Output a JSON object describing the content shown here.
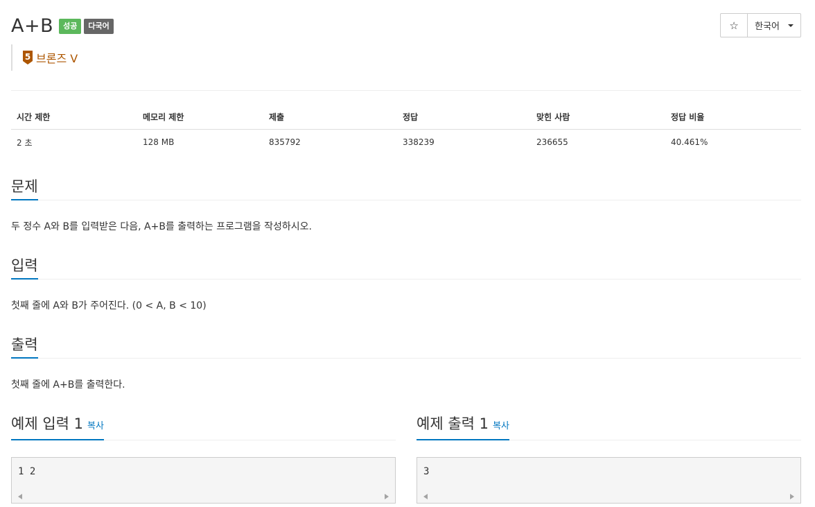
{
  "problem": {
    "title": "A+B",
    "badges": [
      "성공",
      "다국어"
    ],
    "tier": "브론즈 V",
    "tier_number": "5"
  },
  "toolbar": {
    "star": "☆",
    "language": "한국어"
  },
  "info_table": {
    "headers": [
      "시간 제한",
      "메모리 제한",
      "제출",
      "정답",
      "맞힌 사람",
      "정답 비율"
    ],
    "values": [
      "2 초",
      "128 MB",
      "835792",
      "338239",
      "236655",
      "40.461%"
    ]
  },
  "sections": {
    "problem_title": "문제",
    "problem_text": "두 정수 A와 B를 입력받은 다음, A+B를 출력하는 프로그램을 작성하시오.",
    "input_title": "입력",
    "input_text": "첫째 줄에 A와 B가 주어진다. (0 < A, B < 10)",
    "output_title": "출력",
    "output_text": "첫째 줄에 A+B를 출력한다."
  },
  "examples": {
    "input_title": "예제 입력 1",
    "input_copy": "복사",
    "input_value": "1 2",
    "output_title": "예제 출력 1",
    "output_copy": "복사",
    "output_value": "3"
  },
  "colors": {
    "accent": "#0076c0",
    "success_badge": "#5cb85c",
    "multilang_badge": "#666666",
    "bronze": "#ad5600"
  }
}
